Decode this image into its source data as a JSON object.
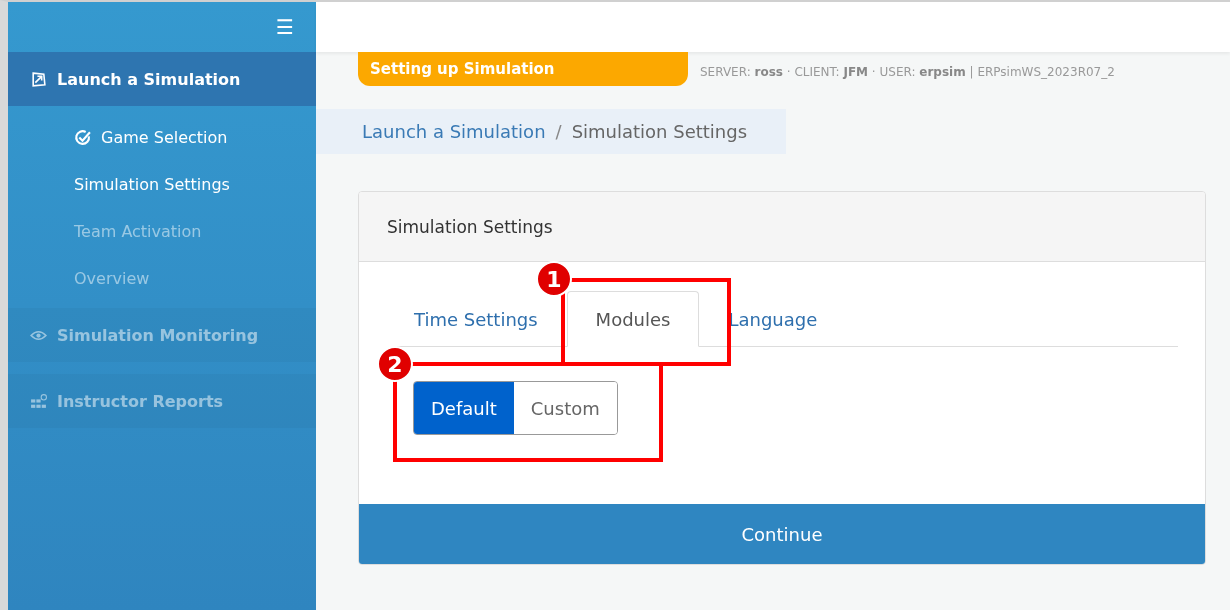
{
  "sidebar": {
    "menu_icon": "☰",
    "items": [
      {
        "label": "Launch a Simulation",
        "kind": "launch",
        "selected": true,
        "disabled": false,
        "children": [
          {
            "label": "Game Selection",
            "done": true,
            "disabled": false
          },
          {
            "label": "Simulation Settings",
            "done": false,
            "disabled": false
          },
          {
            "label": "Team Activation",
            "done": false,
            "disabled": true
          },
          {
            "label": "Overview",
            "done": false,
            "disabled": true
          }
        ]
      },
      {
        "label": "Simulation Monitoring",
        "kind": "monitor",
        "selected": false,
        "disabled": true
      },
      {
        "label": "Instructor Reports",
        "kind": "reports",
        "selected": false,
        "disabled": true
      }
    ]
  },
  "status_banner": "Setting up Simulation",
  "server_info": "SERVER: **ross** · CLIENT: **JFM** · USER: **erpsim** | ERPsimWS_2023R07_2",
  "breadcrumb": {
    "items": [
      "Launch a Simulation",
      "Simulation Settings"
    ],
    "separator": "/"
  },
  "card": {
    "title": "Simulation Settings",
    "tabs": [
      {
        "label": "Time Settings",
        "selected": false
      },
      {
        "label": "Modules",
        "selected": true
      },
      {
        "label": "Language",
        "selected": false
      }
    ],
    "toggle": [
      {
        "label": "Default",
        "selected": true
      },
      {
        "label": "Custom",
        "selected": false
      }
    ],
    "continue_button": "Continue"
  },
  "annotations": [
    {
      "label": "1"
    },
    {
      "label": "2"
    }
  ]
}
